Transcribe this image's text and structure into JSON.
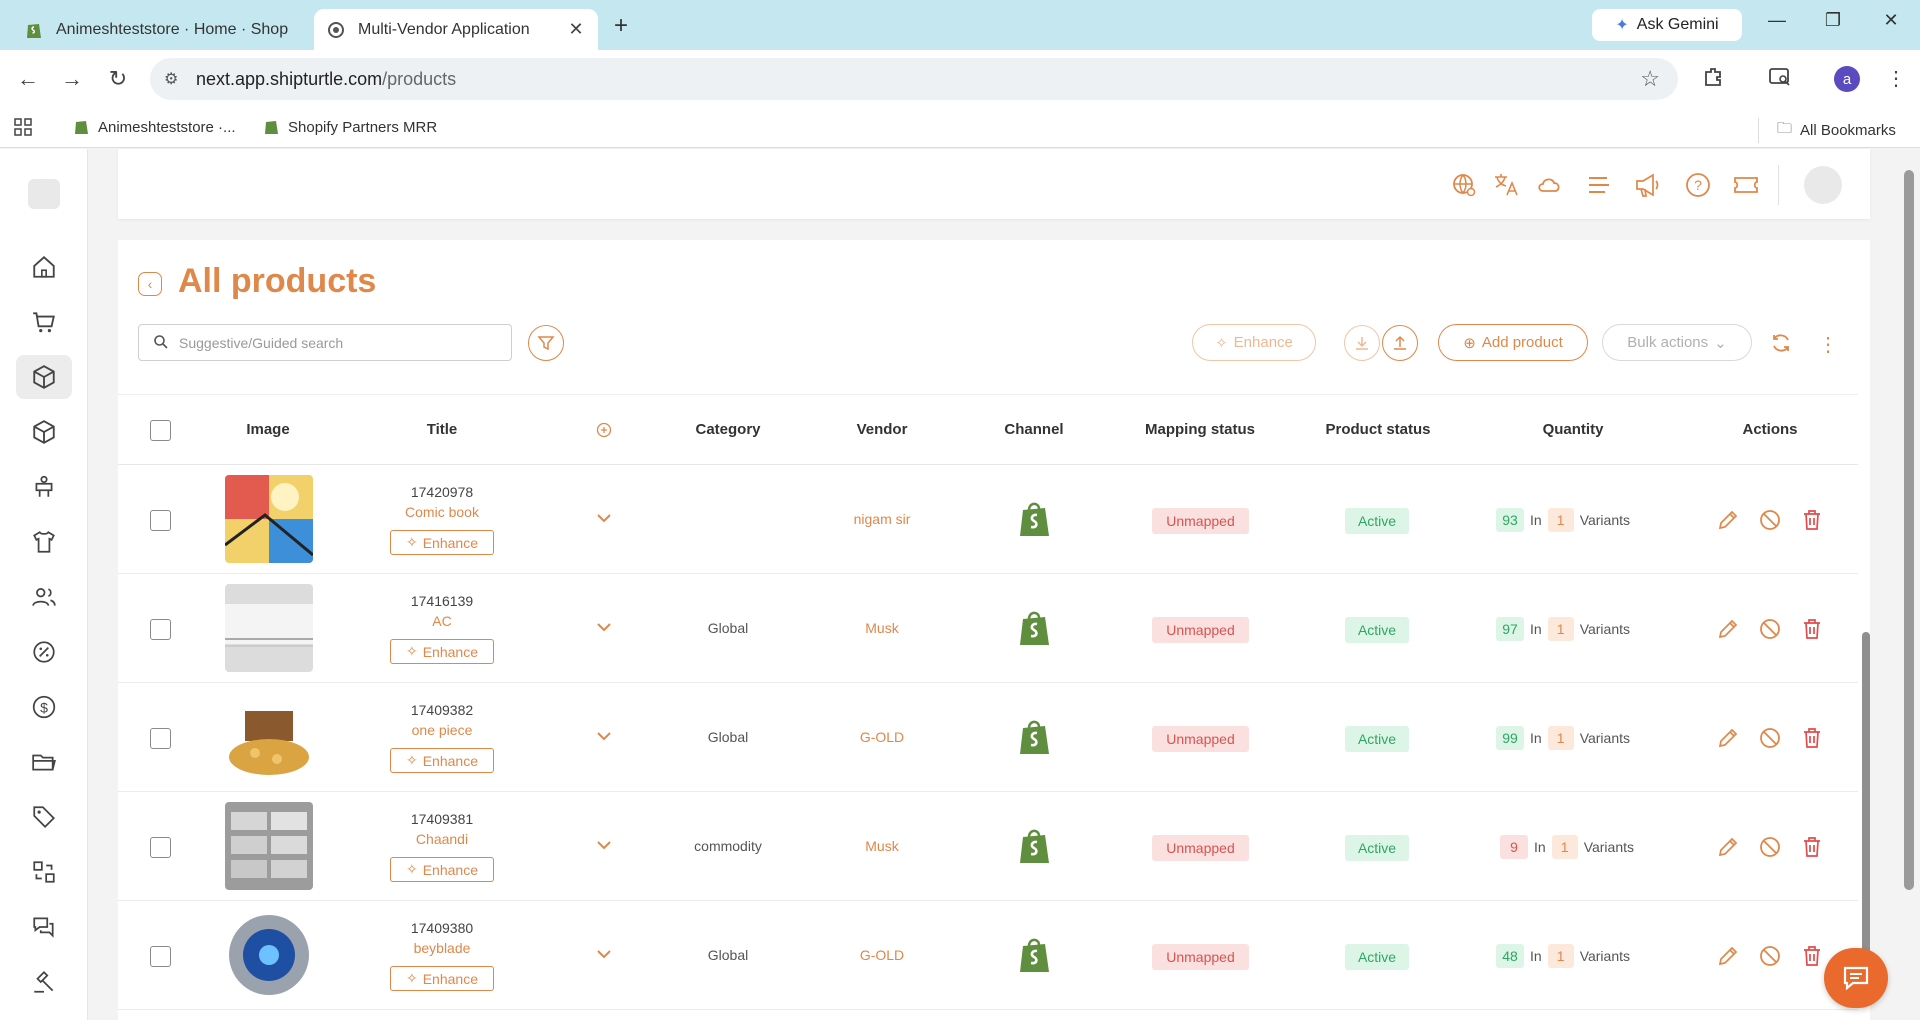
{
  "browser": {
    "tabs": [
      {
        "title": "Animeshteststore · Home · Shop",
        "active": false
      },
      {
        "title": "Multi-Vendor Application",
        "active": true
      }
    ],
    "gemini_label": "Ask Gemini",
    "url_host": "next.app.shipturtle.com",
    "url_path": "/products",
    "profile_initial": "a",
    "bookmarks": [
      "Animeshteststore ·...",
      "Shopify Partners MRR"
    ],
    "all_bookmarks": "All Bookmarks"
  },
  "page": {
    "title": "All products",
    "search_placeholder": "Suggestive/Guided search",
    "buttons": {
      "enhance": "Enhance",
      "add_product": "Add product",
      "bulk_actions": "Bulk actions"
    }
  },
  "table": {
    "headers": {
      "image": "Image",
      "title": "Title",
      "category": "Category",
      "vendor": "Vendor",
      "channel": "Channel",
      "mapping_status": "Mapping status",
      "product_status": "Product status",
      "quantity": "Quantity",
      "actions": "Actions"
    },
    "enhance_label": "Enhance",
    "in_label": "In",
    "variants_label": "Variants",
    "rows": [
      {
        "id": "17420978",
        "name": "Comic book",
        "category": "",
        "vendor": "nigam sir",
        "mapping": "Unmapped",
        "status": "Active",
        "qty": "93",
        "qty_color": "green",
        "variants": "1"
      },
      {
        "id": "17416139",
        "name": "AC",
        "category": "Global",
        "vendor": "Musk",
        "mapping": "Unmapped",
        "status": "Active",
        "qty": "97",
        "qty_color": "green",
        "variants": "1"
      },
      {
        "id": "17409382",
        "name": "one piece",
        "category": "Global",
        "vendor": "G-OLD",
        "mapping": "Unmapped",
        "status": "Active",
        "qty": "99",
        "qty_color": "green",
        "variants": "1"
      },
      {
        "id": "17409381",
        "name": "Chaandi",
        "category": "commodity",
        "vendor": "Musk",
        "mapping": "Unmapped",
        "status": "Active",
        "qty": "9",
        "qty_color": "red",
        "variants": "1"
      },
      {
        "id": "17409380",
        "name": "beyblade",
        "category": "Global",
        "vendor": "G-OLD",
        "mapping": "Unmapped",
        "status": "Active",
        "qty": "48",
        "qty_color": "green",
        "variants": "1"
      }
    ]
  },
  "colors": {
    "accent": "#e0874a",
    "active_green": "#2ea765",
    "unmapped_red": "#d9534f",
    "shopify_green": "#5e8e3e"
  }
}
